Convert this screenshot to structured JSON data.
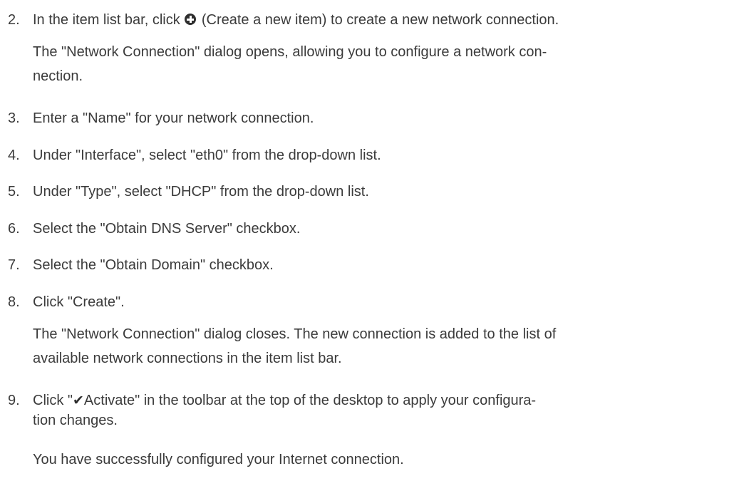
{
  "steps": [
    {
      "num": "2.",
      "pre": "In the item list bar, click ",
      "icon": "plus-circle-icon",
      "post": " (Create a new item) to create a new network connection.",
      "sub": [
        "The \"Network Connection\" dialog opens, allowing you to configure a network con-",
        "nection."
      ]
    },
    {
      "num": "3.",
      "text": "Enter a \"Name\" for your network connection."
    },
    {
      "num": "4.",
      "text": "Under \"Interface\", select \"eth0\" from the drop-down list."
    },
    {
      "num": "5.",
      "text": "Under \"Type\", select \"DHCP\" from the drop-down list."
    },
    {
      "num": "6.",
      "text": "Select the \"Obtain DNS Server\" checkbox."
    },
    {
      "num": "7.",
      "text": "Select the \"Obtain Domain\" checkbox."
    },
    {
      "num": "8.",
      "text": "Click \"Create\".",
      "sub": [
        "The \"Network Connection\" dialog closes. The new connection is added to the list of",
        "available network connections in the item list bar."
      ]
    },
    {
      "num": "9.",
      "pre": "Click \"",
      "icon": "checkmark-icon",
      "mid": "Activate\" in the toolbar at the top of the desktop to apply your configura-",
      "line2": "tion changes.",
      "sub": [
        "You have successfully configured your Internet connection."
      ]
    }
  ]
}
